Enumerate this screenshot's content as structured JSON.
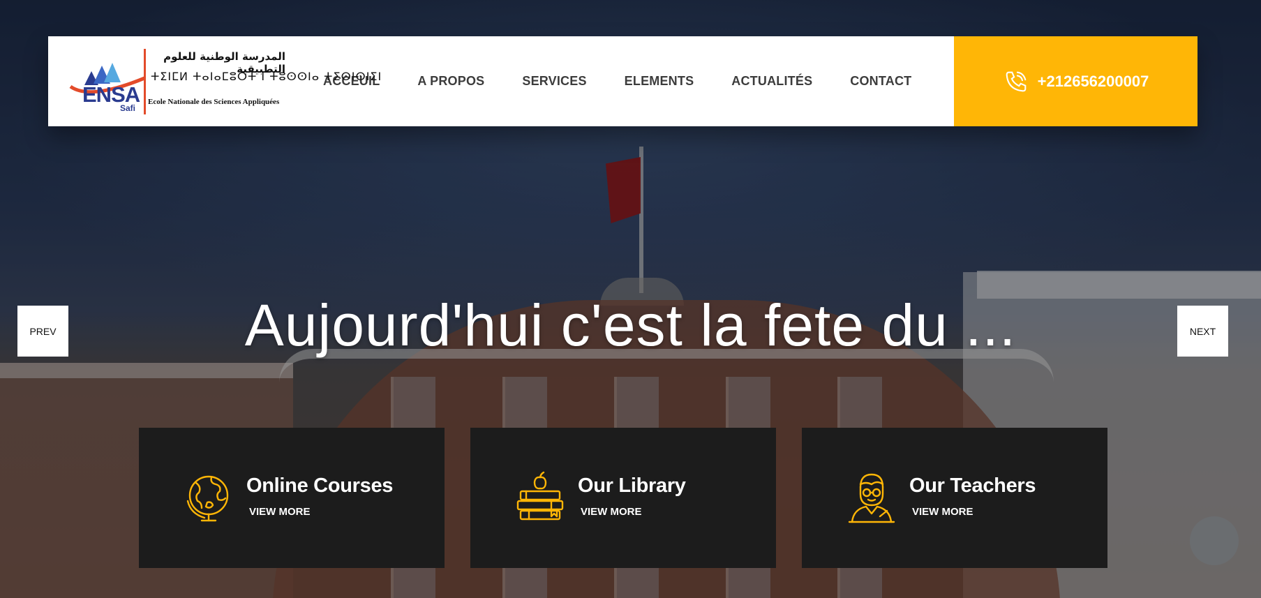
{
  "header": {
    "logo": {
      "ensa": "ENSA",
      "safi": "Safi",
      "arabic": "المدرسة الوطنية للعلوم التطبيقية",
      "tifinagh": "ⵜⵉⵏⵎⵍ ⵜⴰⵏⴰⵎⵓⵔⵜ ⵏ ⵜⵓⵙⵙⵏⴰ ⵜⵉⵙⵏⵙⵏⵉⵏ",
      "french": "Ecole Nationale des Sciences Appliquées"
    },
    "nav": [
      "ACCEUIL",
      "A PROPOS",
      "SERVICES",
      "ELEMENTS",
      "ACTUALITÉS",
      "CONTACT"
    ],
    "phone": "+212656200007"
  },
  "slider": {
    "title": "Aujourd'hui c'est la fete du ...",
    "prev_label": "PREV",
    "next_label": "NEXT"
  },
  "features": [
    {
      "title": "Online Courses",
      "link": "VIEW MORE",
      "icon": "globe-icon"
    },
    {
      "title": "Our Library",
      "link": "VIEW MORE",
      "icon": "books-apple-icon"
    },
    {
      "title": "Our Teachers",
      "link": "VIEW MORE",
      "icon": "teacher-icon"
    }
  ],
  "colors": {
    "accent": "#ffb606",
    "feature_bg": "#1c1c1c",
    "nav_text": "#3c3c3c"
  }
}
